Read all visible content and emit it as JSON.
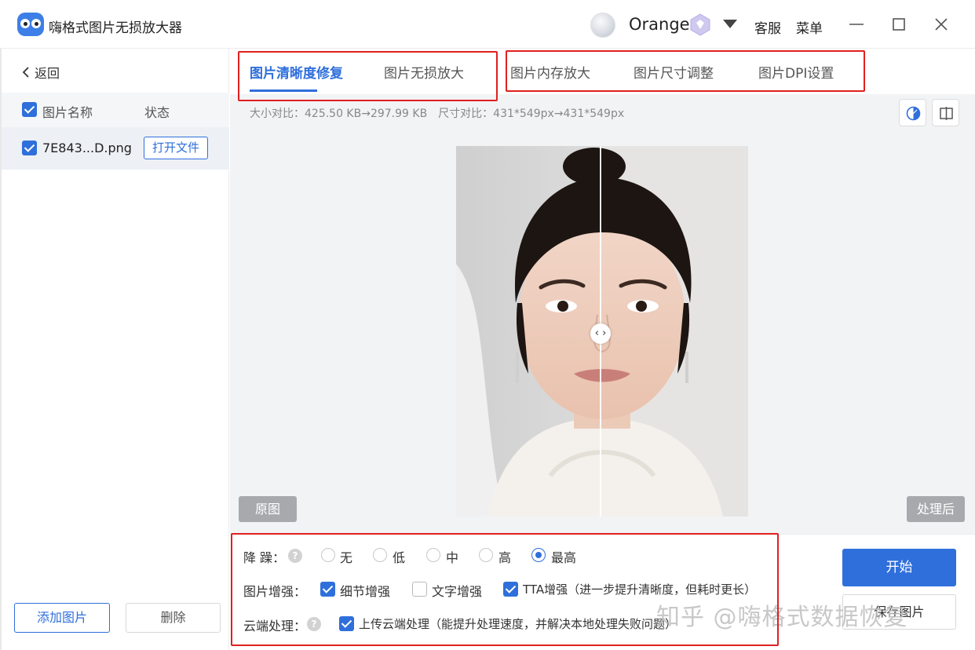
{
  "app": {
    "title": "嗨格式图片无损放大器",
    "username": "Orange",
    "service_label": "客服",
    "menu_label": "菜单"
  },
  "sidebar": {
    "back_label": "返回",
    "header_name": "图片名称",
    "header_status": "状态",
    "files": [
      {
        "name": "7E843...D.png",
        "action_label": "打开文件"
      }
    ],
    "add_label": "添加图片",
    "delete_label": "删除"
  },
  "tabs": [
    {
      "label": "图片清晰度修复",
      "active": true
    },
    {
      "label": "图片无损放大",
      "active": false
    },
    {
      "label": "图片内存放大",
      "active": false
    },
    {
      "label": "图片尺寸调整",
      "active": false
    },
    {
      "label": "图片DPI设置",
      "active": false
    }
  ],
  "compare": {
    "info": "大小对比：425.50 KB→297.99 KB　尺寸对比：431*549px→431*549px",
    "before_label": "原图",
    "after_label": "处理后",
    "handle_glyph": "‹ ›"
  },
  "settings": {
    "denoise_label": "降 躁：",
    "denoise_options": [
      "无",
      "低",
      "中",
      "高",
      "最高"
    ],
    "denoise_selected": "最高",
    "enhance_label": "图片增强：",
    "enhance_options": [
      {
        "label": "细节增强",
        "checked": true
      },
      {
        "label": "文字增强",
        "checked": false
      },
      {
        "label": "TTA增强（进一步提升清晰度，但耗时更长）",
        "checked": true
      }
    ],
    "cloud_label": "云端处理：",
    "cloud_option": {
      "label": "上传云端处理（能提升处理速度，并解决本地处理失败问题）",
      "checked": true
    },
    "help_glyph": "?"
  },
  "actions": {
    "start_label": "开始",
    "save_label": "保存图片"
  },
  "watermark": "知乎 @嗨格式数据恢复",
  "colors": {
    "accent": "#2f6fdb",
    "highlight_box": "#e02020"
  }
}
